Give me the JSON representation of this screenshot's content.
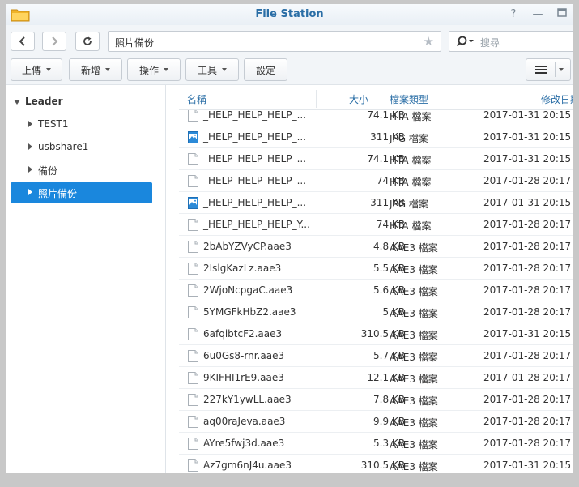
{
  "window": {
    "title": "File Station"
  },
  "toolbar": {
    "path": "照片備份",
    "search_placeholder": "搜尋",
    "buttons": [
      "上傳",
      "新增",
      "操作",
      "工具",
      "設定"
    ]
  },
  "sidebar": {
    "root": "Leader",
    "items": [
      {
        "label": "TEST1"
      },
      {
        "label": "usbshare1"
      },
      {
        "label": "備份"
      },
      {
        "label": "照片備份",
        "selected": true
      }
    ]
  },
  "filelist": {
    "columns": {
      "name": "名稱",
      "size": "大小",
      "type": "檔案類型",
      "modified": "修改日期"
    },
    "rows": [
      {
        "name": "_HELP_HELP_HELP_...",
        "size": "74.1 KB",
        "type": "HTA 檔案",
        "date": "2017-01-31 20:15",
        "icon": "doc"
      },
      {
        "name": "_HELP_HELP_HELP_...",
        "size": "311 KB",
        "type": "JPG 檔案",
        "date": "2017-01-31 20:15",
        "icon": "image"
      },
      {
        "name": "_HELP_HELP_HELP_...",
        "size": "74.1 KB",
        "type": "HTA 檔案",
        "date": "2017-01-31 20:15",
        "icon": "doc"
      },
      {
        "name": "_HELP_HELP_HELP_...",
        "size": "74 KB",
        "type": "HTA 檔案",
        "date": "2017-01-28 20:17",
        "icon": "doc"
      },
      {
        "name": "_HELP_HELP_HELP_...",
        "size": "311 KB",
        "type": "JPG 檔案",
        "date": "2017-01-31 20:15",
        "icon": "image"
      },
      {
        "name": "_HELP_HELP_HELP_Y...",
        "size": "74 KB",
        "type": "HTA 檔案",
        "date": "2017-01-28 20:17",
        "icon": "doc"
      },
      {
        "name": "2bAbYZVyCP.aae3",
        "size": "4.8 KB",
        "type": "AAE3 檔案",
        "date": "2017-01-28 20:17",
        "icon": "doc"
      },
      {
        "name": "2IslgKazLz.aae3",
        "size": "5.5 KB",
        "type": "AAE3 檔案",
        "date": "2017-01-28 20:17",
        "icon": "doc"
      },
      {
        "name": "2WjoNcpgaC.aae3",
        "size": "5.6 KB",
        "type": "AAE3 檔案",
        "date": "2017-01-28 20:17",
        "icon": "doc"
      },
      {
        "name": "5YMGFkHbZ2.aae3",
        "size": "5 KB",
        "type": "AAE3 檔案",
        "date": "2017-01-28 20:17",
        "icon": "doc"
      },
      {
        "name": "6afqibtcF2.aae3",
        "size": "310.5 KB",
        "type": "AAE3 檔案",
        "date": "2017-01-31 20:15",
        "icon": "doc"
      },
      {
        "name": "6u0Gs8-rnr.aae3",
        "size": "5.7 KB",
        "type": "AAE3 檔案",
        "date": "2017-01-28 20:17",
        "icon": "doc"
      },
      {
        "name": "9KIFHI1rE9.aae3",
        "size": "12.1 KB",
        "type": "AAE3 檔案",
        "date": "2017-01-28 20:17",
        "icon": "doc"
      },
      {
        "name": "227kY1ywLL.aae3",
        "size": "7.8 KB",
        "type": "AAE3 檔案",
        "date": "2017-01-28 20:17",
        "icon": "doc"
      },
      {
        "name": "aq00raJeva.aae3",
        "size": "9.9 KB",
        "type": "AAE3 檔案",
        "date": "2017-01-28 20:17",
        "icon": "doc"
      },
      {
        "name": "AYre5fwj3d.aae3",
        "size": "5.3 KB",
        "type": "AAE3 檔案",
        "date": "2017-01-28 20:17",
        "icon": "doc"
      },
      {
        "name": "Az7gm6nJ4u.aae3",
        "size": "310.5 KB",
        "type": "AAE3 檔案",
        "date": "2017-01-31 20:15",
        "icon": "doc"
      }
    ]
  },
  "colors": {
    "accent": "#1a87dd",
    "title": "#2a6ea6"
  }
}
